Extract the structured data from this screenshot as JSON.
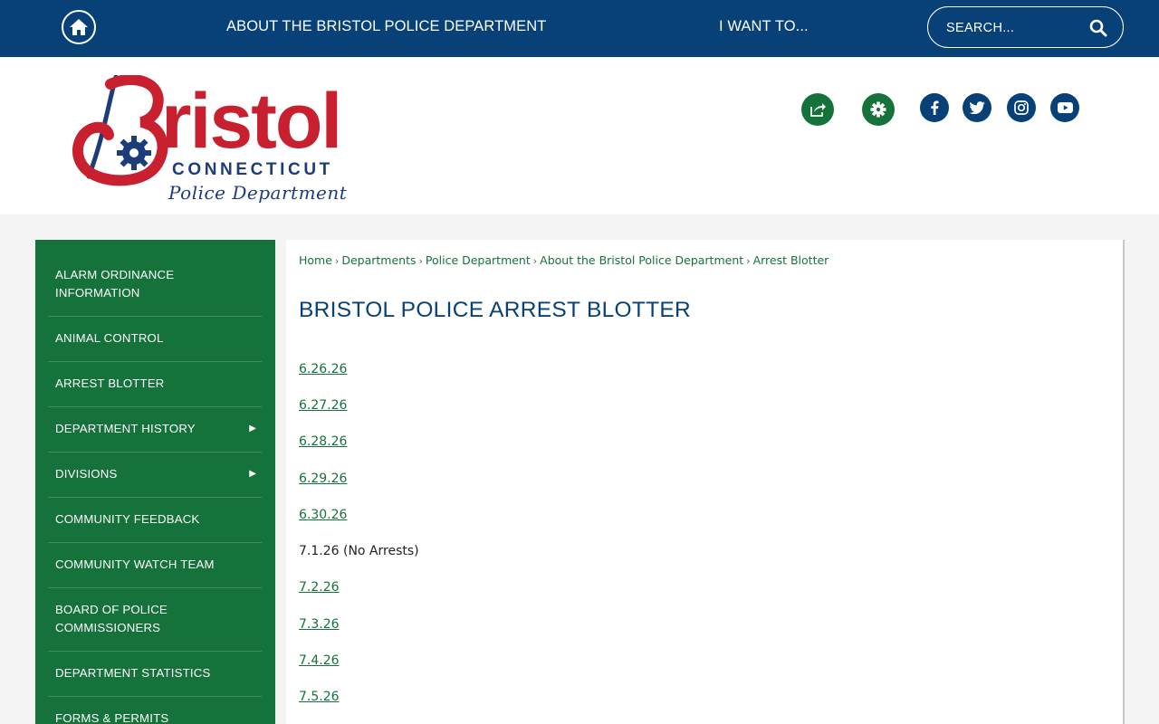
{
  "topnav": {
    "about": "ABOUT THE BRISTOL POLICE DEPARTMENT",
    "iwant": "I WANT TO...",
    "search_placeholder": "SEARCH..."
  },
  "logo": {
    "word": "ristol",
    "state": "CONNECTICUT",
    "dept": "Police Department"
  },
  "colors": {
    "navy": "#074178",
    "green": "#15723a",
    "red": "#c8202f"
  },
  "header_icons": [
    "share-icon",
    "gear-icon",
    "facebook-icon",
    "twitter-icon",
    "instagram-icon",
    "youtube-icon"
  ],
  "sidebar": {
    "items": [
      {
        "label": "ALARM ORDINANCE INFORMATION",
        "has_submenu": false
      },
      {
        "label": "ANIMAL CONTROL",
        "has_submenu": false
      },
      {
        "label": "ARREST BLOTTER",
        "has_submenu": false
      },
      {
        "label": "DEPARTMENT HISTORY",
        "has_submenu": true
      },
      {
        "label": "DIVISIONS",
        "has_submenu": true
      },
      {
        "label": "COMMUNITY FEEDBACK",
        "has_submenu": false
      },
      {
        "label": "COMMUNITY WATCH TEAM",
        "has_submenu": false
      },
      {
        "label": "BOARD OF POLICE COMMISSIONERS",
        "has_submenu": false
      },
      {
        "label": "DEPARTMENT STATISTICS",
        "has_submenu": false
      },
      {
        "label": "FORMS & PERMITS",
        "has_submenu": false
      }
    ],
    "arrow": "▶"
  },
  "breadcrumb": {
    "items": [
      "Home",
      "Departments",
      "Police Department",
      "About the Bristol Police Department",
      "Arrest Blotter"
    ],
    "sep": "›"
  },
  "main": {
    "title": "BRISTOL POLICE ARREST BLOTTER",
    "entries": [
      {
        "text": "6.26.26",
        "link": true
      },
      {
        "text": "6.27.26",
        "link": true
      },
      {
        "text": "6.28.26",
        "link": true
      },
      {
        "text": "6.29.26",
        "link": true
      },
      {
        "text": "6.30.26",
        "link": true
      },
      {
        "text": "7.1.26 (No Arrests)",
        "link": false
      },
      {
        "text": "7.2.26",
        "link": true
      },
      {
        "text": "7.3.26",
        "link": true
      },
      {
        "text": "7.4.26",
        "link": true
      },
      {
        "text": "7.5.26",
        "link": true
      }
    ]
  }
}
